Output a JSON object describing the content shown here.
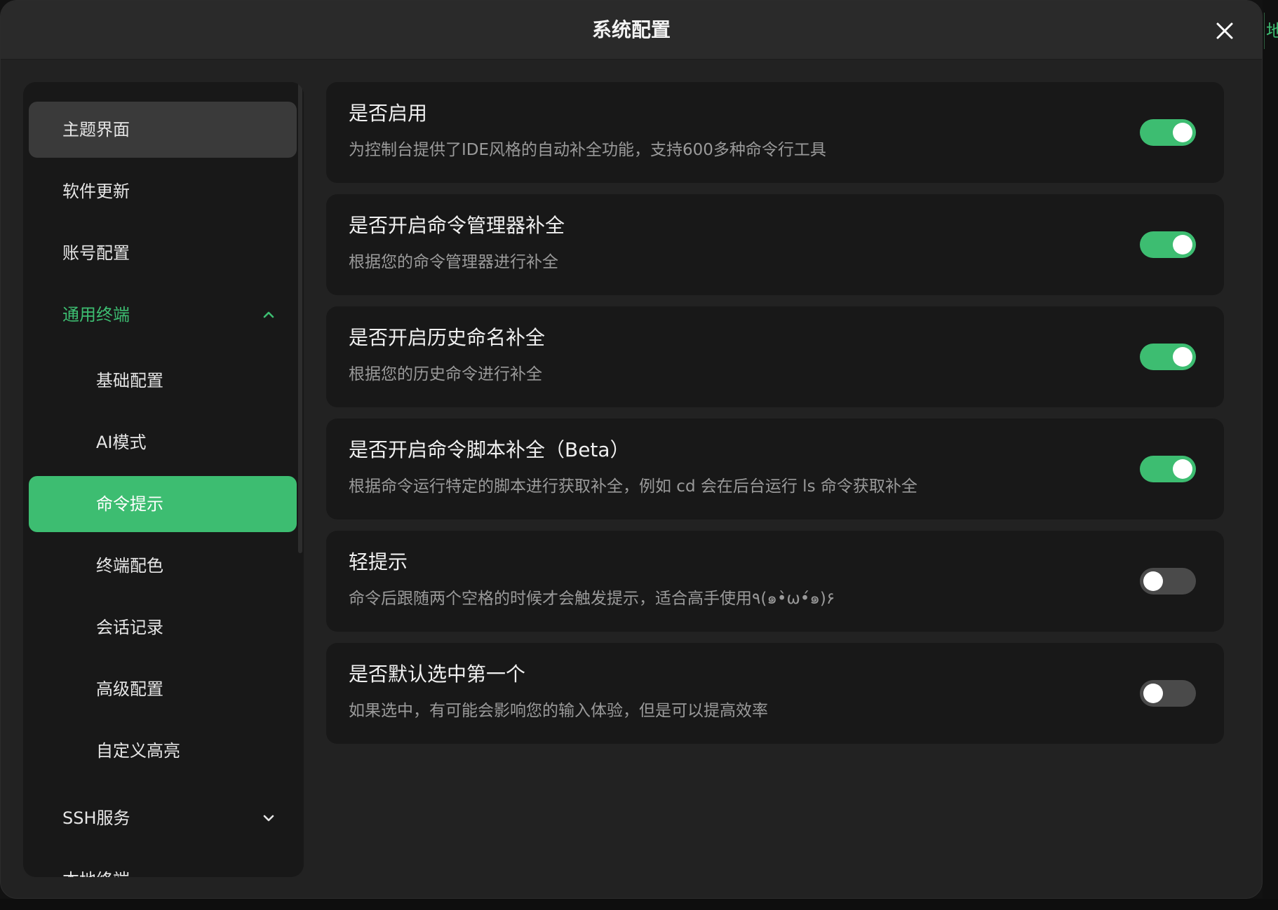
{
  "dialog": {
    "title": "系统配置",
    "close_icon": "close-icon"
  },
  "backdrop": {
    "hint_text": "地"
  },
  "sidebar": {
    "items": [
      {
        "label": "主题界面",
        "state": "hover"
      },
      {
        "label": "软件更新",
        "state": "normal"
      },
      {
        "label": "账号配置",
        "state": "normal"
      },
      {
        "label": "通用终端",
        "state": "expanded",
        "icon": "chevron-up-icon"
      },
      {
        "label": "基础配置",
        "state": "sub"
      },
      {
        "label": "AI模式",
        "state": "sub"
      },
      {
        "label": "命令提示",
        "state": "active"
      },
      {
        "label": "终端配色",
        "state": "sub"
      },
      {
        "label": "会话记录",
        "state": "sub"
      },
      {
        "label": "高级配置",
        "state": "sub"
      },
      {
        "label": "自定义高亮",
        "state": "sub"
      },
      {
        "label": "SSH服务",
        "state": "collapsed",
        "icon": "chevron-down-icon"
      },
      {
        "label": "本地终端",
        "state": "partially-visible"
      }
    ]
  },
  "settings": [
    {
      "title": "是否启用",
      "description": "为控制台提供了IDE风格的自动补全功能，支持600多种命令行工具",
      "enabled": true
    },
    {
      "title": "是否开启命令管理器补全",
      "description": "根据您的命令管理器进行补全",
      "enabled": true
    },
    {
      "title": "是否开启历史命名补全",
      "description": "根据您的历史命令进行补全",
      "enabled": true
    },
    {
      "title": "是否开启命令脚本补全（Beta）",
      "description": "根据命令运行特定的脚本进行获取补全，例如 cd 会在后台运行 ls 命令获取补全",
      "enabled": true
    },
    {
      "title": "轻提示",
      "description": "命令后跟随两个空格的时候才会触发提示，适合高手使用٩(๑•̀ω•́๑)۶",
      "enabled": false
    },
    {
      "title": "是否默认选中第一个",
      "description": "如果选中，有可能会影响您的输入体验，但是可以提高效率",
      "enabled": false
    }
  ],
  "colors": {
    "accent": "#3dbd71",
    "dialog_bg": "#222222",
    "card_bg": "#181818",
    "toggle_off": "#4a4a4a"
  }
}
